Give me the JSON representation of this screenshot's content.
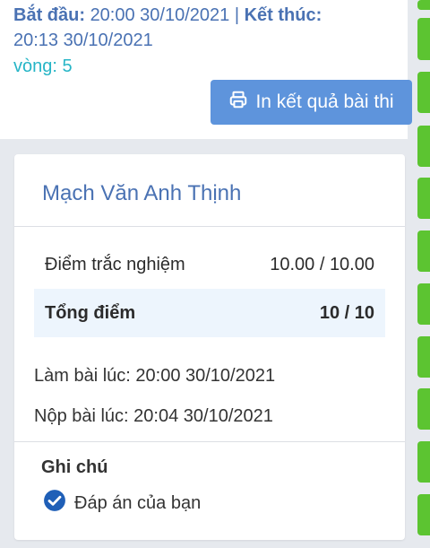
{
  "header": {
    "start_label": "Bắt đầu:",
    "start_value": "20:00 30/10/2021",
    "separator": "|",
    "end_label": "Kết thúc:",
    "end_value": "20:13 30/10/2021",
    "round_text": "vòng: 5",
    "print_button_label": "In kết quả bài thi",
    "print_icon": "printer-icon"
  },
  "result": {
    "student_name": "Mạch Văn Anh Thịnh",
    "rows": [
      {
        "label": "Điểm trắc nghiệm",
        "value": "10.00 / 10.00"
      },
      {
        "label": "Tổng điểm",
        "value": "10 / 10"
      }
    ],
    "started_at": "Làm bài lúc: 20:00 30/10/2021",
    "submitted_at": "Nộp bài lúc: 20:04 30/10/2021",
    "notes_title": "Ghi chú",
    "legend_label": "Đáp án của bạn",
    "legend_icon": "check-circle-icon"
  },
  "colors": {
    "accent_blue": "#4a72b3",
    "teal": "#26b5c6",
    "button": "#5e94dc",
    "green_status": "#5cc431",
    "check_blue": "#1f5fb7"
  }
}
